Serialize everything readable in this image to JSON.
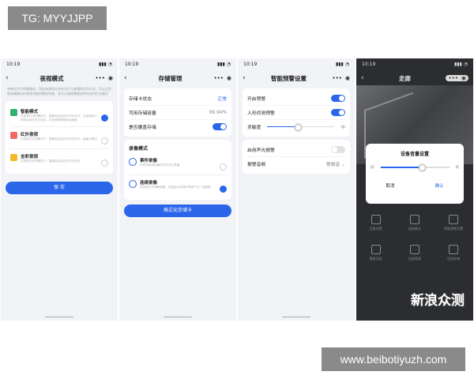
{
  "overlay_tag": "TG: MYYJJPP",
  "overlay_url": "www.beibotiyuzh.com",
  "watermark": {
    "big": "新浪众测",
    "small": ""
  },
  "status_time": "10:19",
  "phone1": {
    "title": "夜视模式",
    "desc": "带有红外灯的摄像机，包括有源的红外补光灯与普通的LED白光，可以让您获取摄像机的夜视功能的最佳效果。您可以根据需要选择适合的灯光模式",
    "options": [
      {
        "title": "智能模式",
        "desc": "在没有灯光的情况下，摄像机会自动打开红外灯，当检测到人形时自动打开白光灯。可在夜间获取彩色画面",
        "selected": true,
        "color": "#2fb36e"
      },
      {
        "title": "红外夜视",
        "desc": "在没有灯光的情况下，摄像机会自动打开红外灯，画面为黑白",
        "selected": false,
        "color": "#f06a6a"
      },
      {
        "title": "全彩夜视",
        "desc": "在没有灯光的情况下，摄像机会自动打开白光灯",
        "selected": false,
        "color": "#f3b92a"
      }
    ],
    "save_label": "保 存"
  },
  "phone2": {
    "title": "存储管理",
    "rows": [
      {
        "label": "存储卡状态",
        "value": "正常"
      },
      {
        "label": "可用存储容量",
        "value": "99.94%"
      },
      {
        "label": "是否覆盖存储",
        "value": ""
      }
    ],
    "record_section": "录像模式",
    "modes": [
      {
        "title": "事件录像",
        "desc": "只有当检测到事件时才进行录像",
        "selected": false
      },
      {
        "title": "连续录像",
        "desc": "全天进行不间断录像，可能会对存储卡寿命产生一定影响",
        "selected": true
      }
    ],
    "format_label": "格式化存储卡"
  },
  "phone3": {
    "title": "智能预警设置",
    "rows": [
      {
        "label": "开启预警",
        "toggle": true
      },
      {
        "label": "人形侦测预警",
        "toggle": true
      }
    ],
    "sensitivity_label": "灵敏度",
    "sensitivity_value": 0.45,
    "sensitivity_max": "中",
    "rows2": [
      {
        "label": "启用声光报警",
        "value": ""
      },
      {
        "label": "报警音频",
        "value": "警报音"
      }
    ]
  },
  "phone4": {
    "title": "走廊",
    "dialog_title": "设备音量设置",
    "low": "低",
    "high": "高",
    "volume": 0.6,
    "cancel": "取消",
    "confirm": "确认",
    "grid": [
      "音量设置",
      "画质模式",
      "智能预警设置",
      "看看远程",
      "回放管理",
      "回放存储"
    ]
  }
}
